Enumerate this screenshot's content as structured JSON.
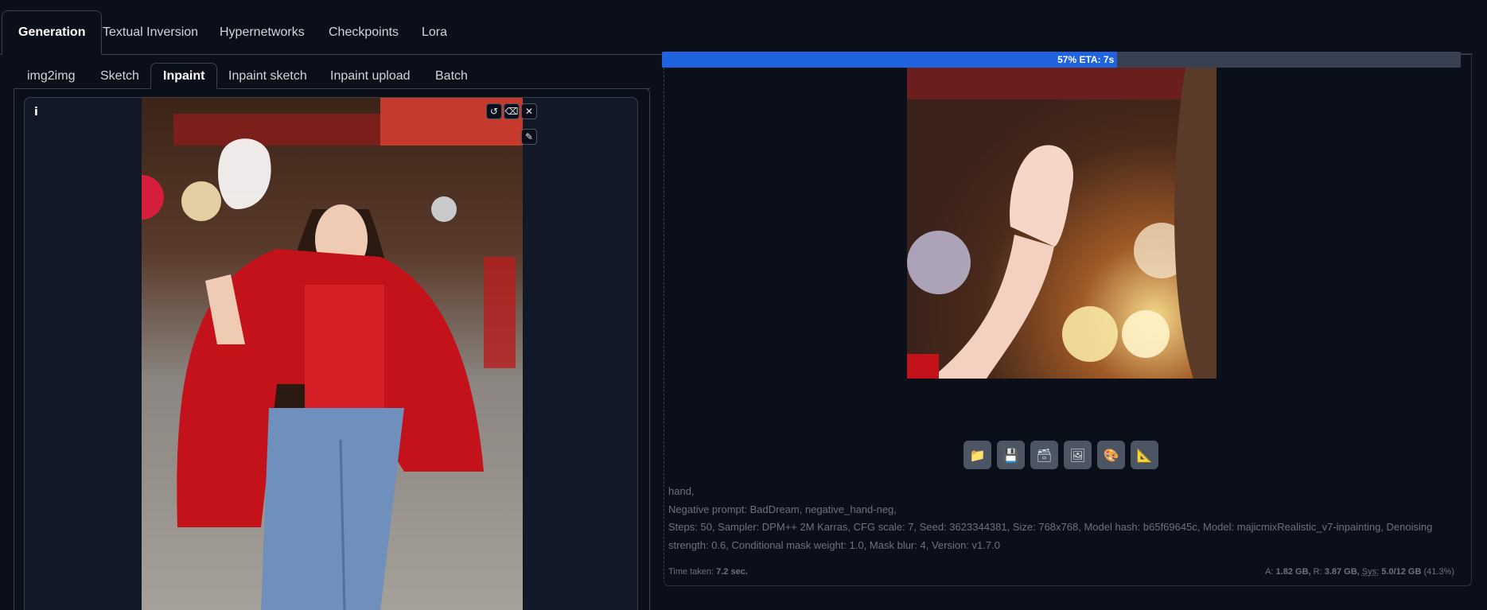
{
  "top_tabs": [
    {
      "label": "Generation",
      "active": true
    },
    {
      "label": "Textual Inversion",
      "active": false
    },
    {
      "label": "Hypernetworks",
      "active": false
    },
    {
      "label": "Checkpoints",
      "active": false
    },
    {
      "label": "Lora",
      "active": false
    }
  ],
  "sub_tabs": [
    {
      "label": "img2img",
      "active": false
    },
    {
      "label": "Sketch",
      "active": false
    },
    {
      "label": "Inpaint",
      "active": true
    },
    {
      "label": "Inpaint sketch",
      "active": false
    },
    {
      "label": "Inpaint upload",
      "active": false
    },
    {
      "label": "Batch",
      "active": false
    }
  ],
  "canvas": {
    "info_label": "i",
    "tools": [
      {
        "icon": "undo-icon",
        "glyph": "↺"
      },
      {
        "icon": "eraser-icon",
        "glyph": "⌫"
      },
      {
        "icon": "close-icon",
        "glyph": "✕"
      },
      {
        "icon": "brush-icon",
        "glyph": "✎"
      }
    ]
  },
  "progress": {
    "percent": 57,
    "label": "57% ETA: 7s",
    "color": "#1f63e0"
  },
  "actions": [
    {
      "icon": "folder-icon",
      "glyph": "📁"
    },
    {
      "icon": "save-icon",
      "glyph": "💾"
    },
    {
      "icon": "zip-icon",
      "glyph": "🗃"
    },
    {
      "icon": "image-icon",
      "glyph": "🖼"
    },
    {
      "icon": "palette-icon",
      "glyph": "🎨"
    },
    {
      "icon": "ruler-icon",
      "glyph": "📐"
    }
  ],
  "generation_info": {
    "prompt": "hand,",
    "negative": "Negative prompt: BadDream, negative_hand-neg,",
    "params": "Steps: 50, Sampler: DPM++ 2M Karras, CFG scale: 7, Seed: 3623344381, Size: 768x768, Model hash: b65f69645c, Model: majicmixRealistic_v7-inpainting, Denoising strength: 0.6, Conditional mask weight: 1.0, Mask blur: 4, Version: v1.7.0"
  },
  "footer": {
    "time_label": "Time taken:",
    "time_value": "7.2 sec.",
    "vram_a_label": "A:",
    "vram_a": "1.82 GB,",
    "vram_r_label": "R:",
    "vram_r": "3.87 GB,",
    "vram_sys_label": "Sys:",
    "vram_sys": "5.0/12 GB",
    "vram_pct": "(41.3%)"
  }
}
